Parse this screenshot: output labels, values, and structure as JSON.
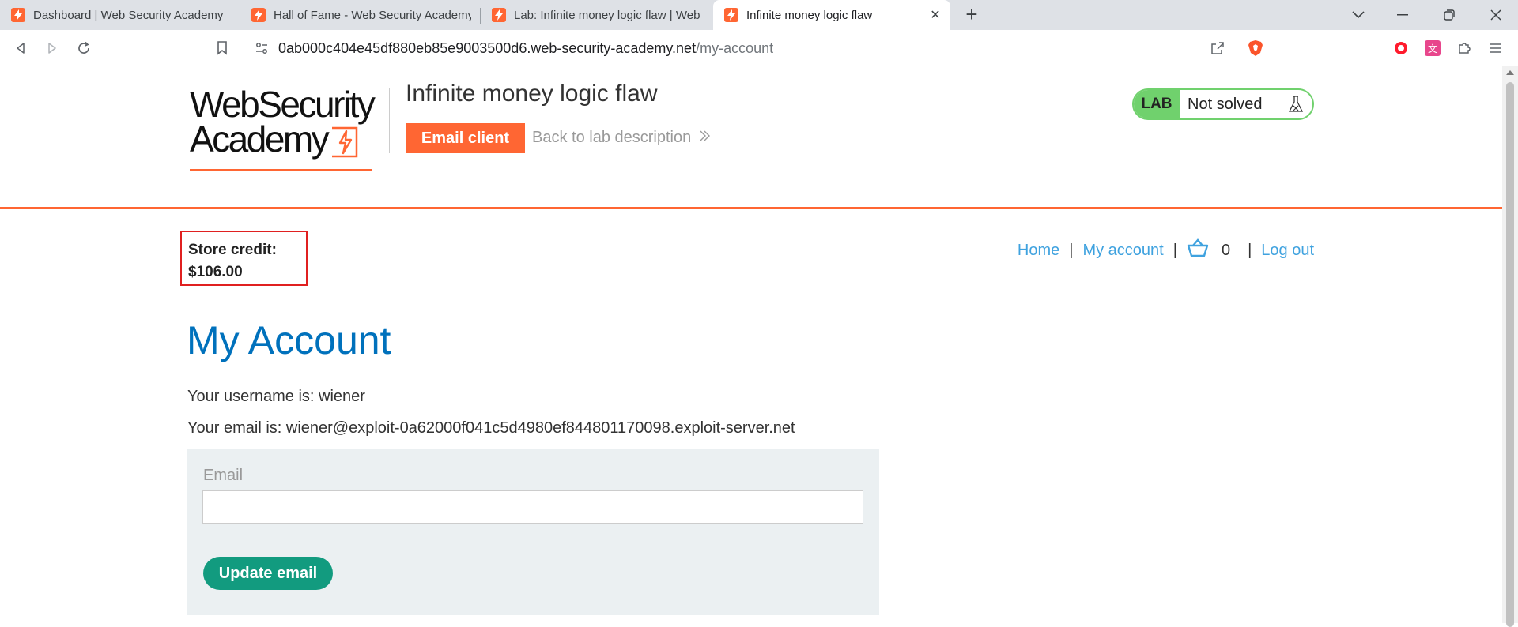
{
  "browser": {
    "tabs": [
      {
        "title": "Dashboard | Web Security Academy",
        "active": false
      },
      {
        "title": "Hall of Fame - Web Security Academy",
        "active": false
      },
      {
        "title": "Lab: Infinite money logic flaw | Web Security Academy",
        "active": false
      },
      {
        "title": "Infinite money logic flaw",
        "active": true
      }
    ],
    "address": {
      "host": "0ab000c404e45df880eb85e9003500d6.web-security-academy.net",
      "path": "/my-account"
    }
  },
  "header": {
    "logo_line1": "WebSecurity",
    "logo_line2": "Academy",
    "lab_title": "Infinite money logic flaw",
    "email_client_label": "Email client",
    "back_link_label": "Back to lab description",
    "lab_badge": "LAB",
    "lab_status": "Not solved"
  },
  "store_credit": {
    "label": "Store credit:",
    "amount": "$106.00"
  },
  "nav": {
    "home": "Home",
    "my_account": "My account",
    "cart_count": "0",
    "log_out": "Log out",
    "separator": "|"
  },
  "account": {
    "heading": "My Account",
    "username_line": "Your username is: wiener",
    "email_line": "Your email is: wiener@exploit-0a62000f041c5d4980ef844801170098.exploit-server.net",
    "email_field_label": "Email",
    "email_field_value": "",
    "update_button": "Update email"
  },
  "colors": {
    "brand_orange": "#ff6633",
    "link_blue": "#3fa2df",
    "heading_blue": "#0071bc",
    "lab_green": "#70d16d",
    "button_green": "#129b7f",
    "highlight_red": "#e02020"
  }
}
